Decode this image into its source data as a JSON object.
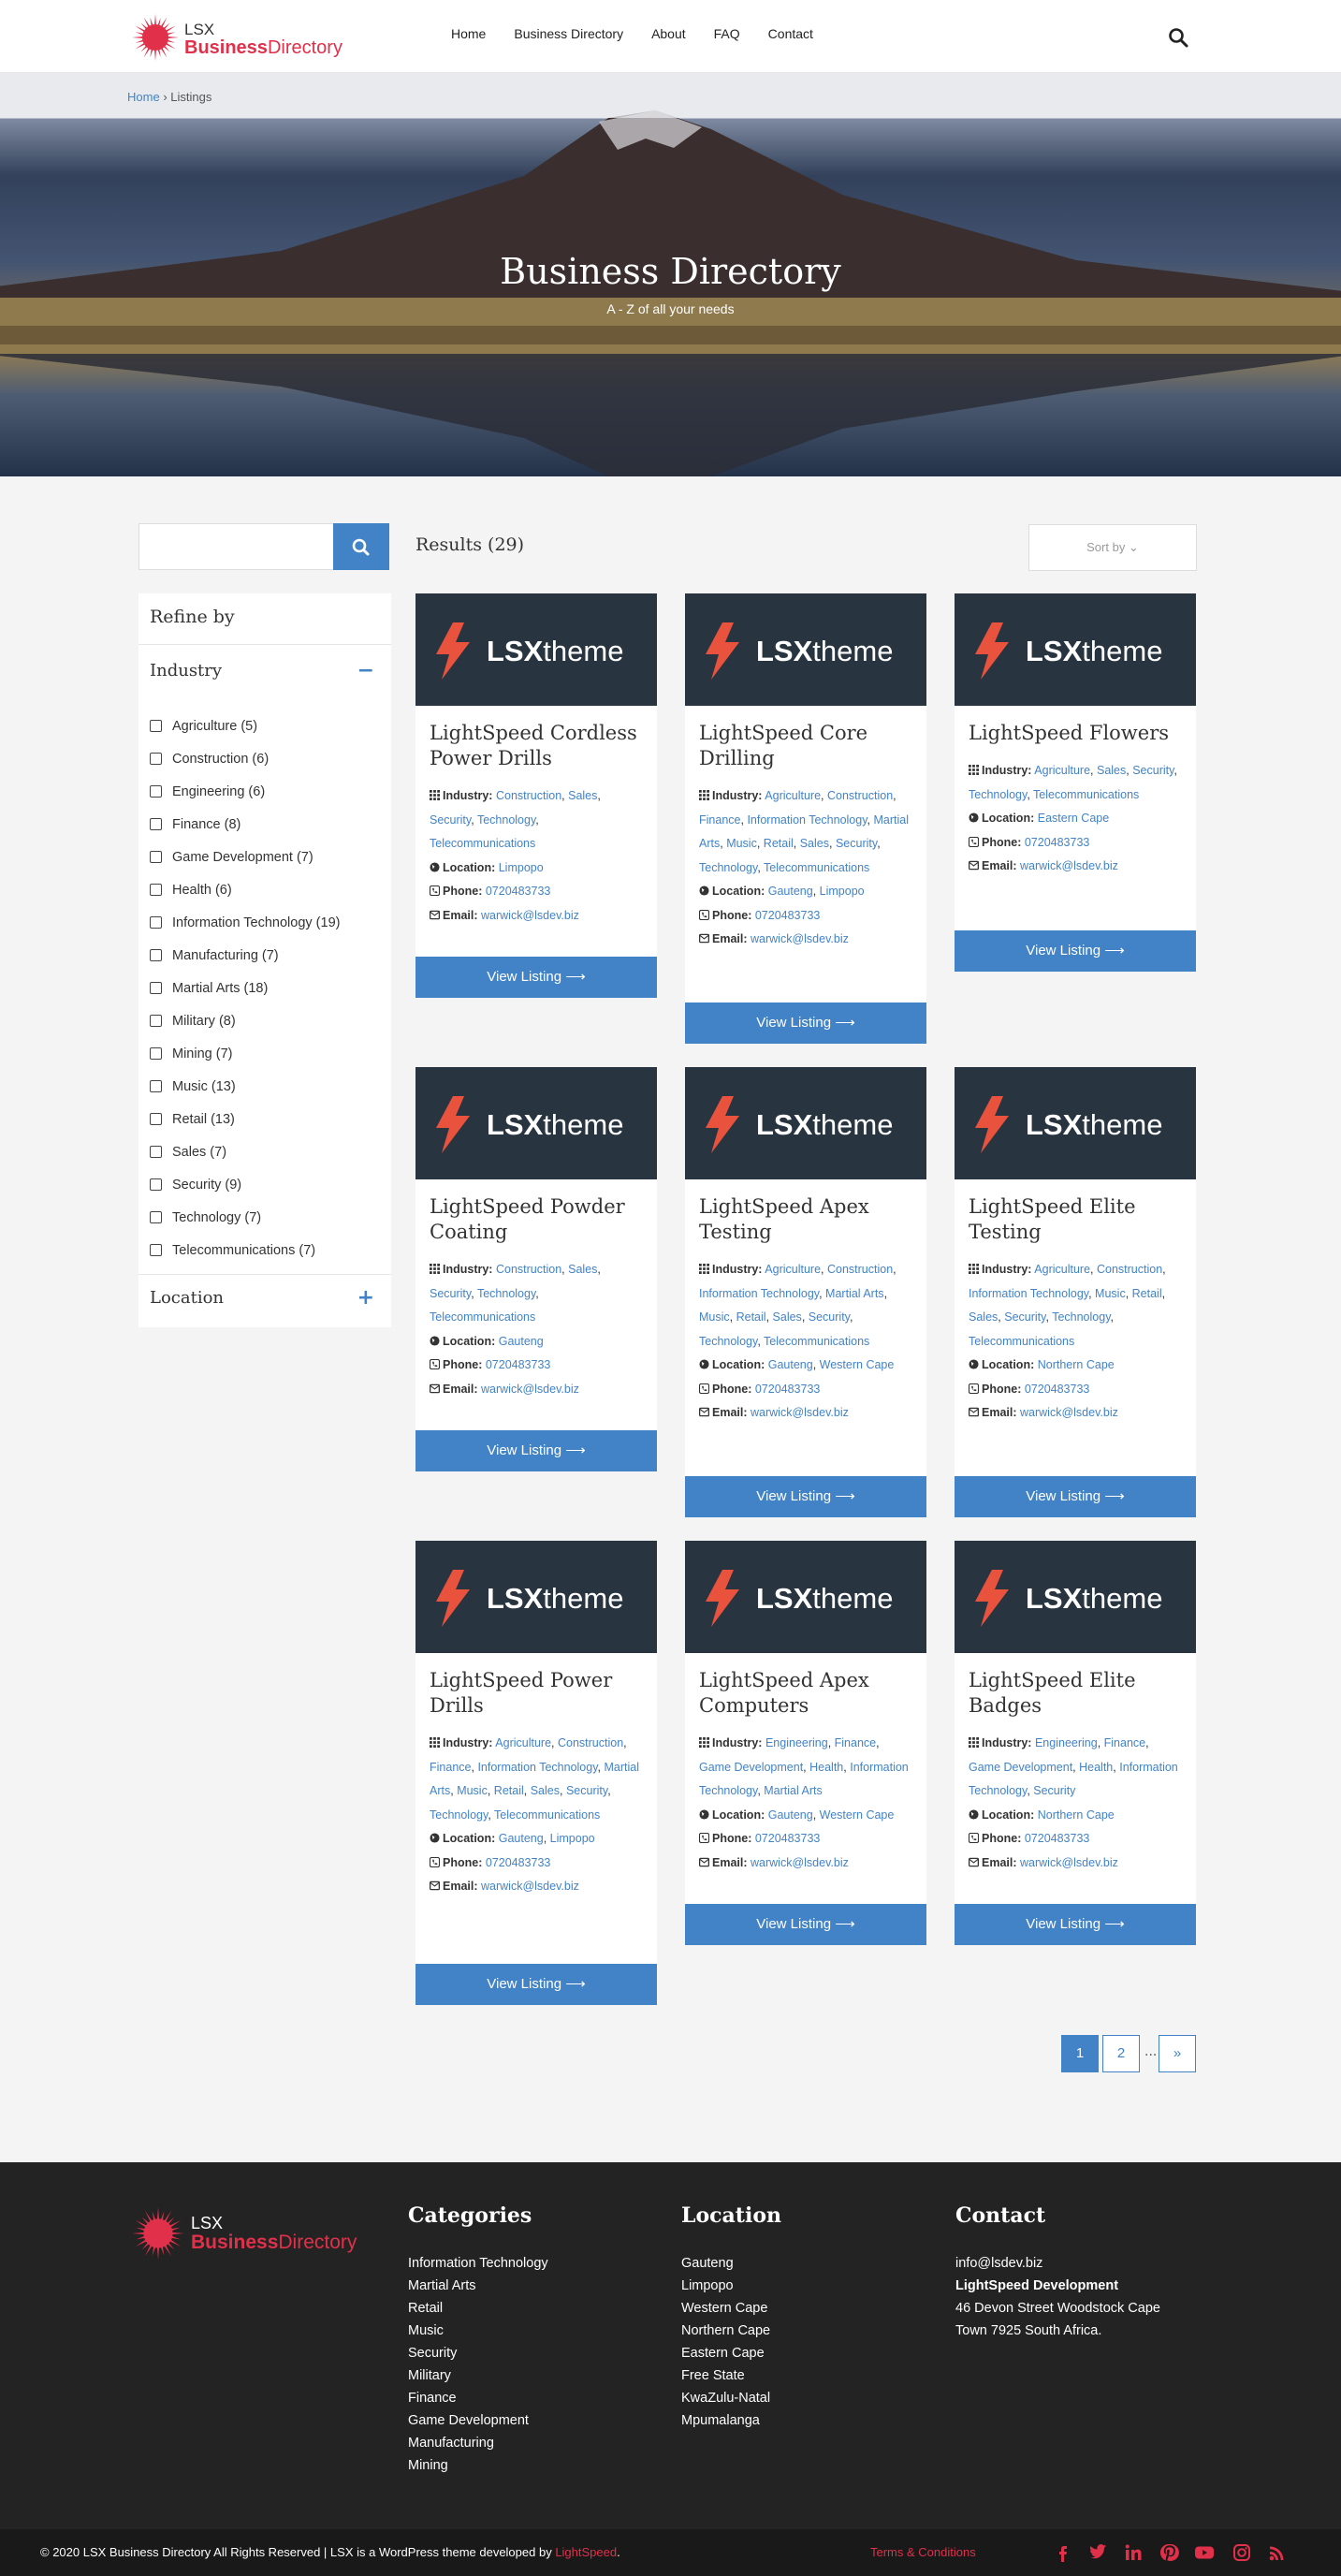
{
  "header": {
    "logo_top": "LSX",
    "logo_bold": "Business",
    "logo_rest": "Directory",
    "nav": [
      "Home",
      "Business Directory",
      "About",
      "FAQ",
      "Contact"
    ]
  },
  "breadcrumb": {
    "home": "Home",
    "sep": "›",
    "current": "Listings"
  },
  "hero": {
    "title": "Business Directory",
    "subtitle": "A - Z of all your needs"
  },
  "search": {
    "value": "",
    "placeholder": ""
  },
  "filters": {
    "refine_label": "Refine by",
    "industry_label": "Industry",
    "industry_toggle": "−",
    "location_label": "Location",
    "location_toggle": "+",
    "industries": [
      "Agriculture (5)",
      "Construction (6)",
      "Engineering (6)",
      "Finance (8)",
      "Game Development (7)",
      "Health (6)",
      "Information Technology (19)",
      "Manufacturing (7)",
      "Martial Arts (18)",
      "Military (8)",
      "Mining (7)",
      "Music (13)",
      "Retail (13)",
      "Sales (7)",
      "Security (9)",
      "Technology (7)",
      "Telecommunications (7)"
    ]
  },
  "results": {
    "label": "Results (29)",
    "sort_label": "Sort by ⌄"
  },
  "labels": {
    "industry": "Industry:",
    "location": "Location:",
    "phone": "Phone:",
    "email": "Email:",
    "view": "View Listing ⟶",
    "thumb_bold": "LSX",
    "thumb_rest": "theme"
  },
  "listings": [
    {
      "title": "LightSpeed Cordless Power Drills",
      "industry": "Construction, Sales, Security, Technology, Telecommunications",
      "location": "Limpopo",
      "phone": "0720483733",
      "email": "warwick@lsdev.biz"
    },
    {
      "title": "LightSpeed Core Drilling",
      "industry": "Agriculture, Construction, Finance, Information Technology, Martial Arts, Music, Retail, Sales, Security, Technology, Telecommunications",
      "location": "Gauteng, Limpopo",
      "phone": "0720483733",
      "email": "warwick@lsdev.biz"
    },
    {
      "title": "LightSpeed Flowers",
      "industry": "Agriculture, Sales, Security, Technology, Telecommunications",
      "location": "Eastern Cape",
      "phone": "0720483733",
      "email": "warwick@lsdev.biz"
    },
    {
      "title": "LightSpeed Powder Coating",
      "industry": "Construction, Sales, Security, Technology, Telecommunications",
      "location": "Gauteng",
      "phone": "0720483733",
      "email": "warwick@lsdev.biz"
    },
    {
      "title": "LightSpeed Apex Testing",
      "industry": "Agriculture, Construction, Information Technology, Martial Arts, Music, Retail, Sales, Security, Technology, Telecommunications",
      "location": "Gauteng, Western Cape",
      "phone": "0720483733",
      "email": "warwick@lsdev.biz"
    },
    {
      "title": "LightSpeed Elite Testing",
      "industry": "Agriculture, Construction, Information Technology, Music, Retail, Sales, Security, Technology, Telecommunications",
      "location": "Northern Cape",
      "phone": "0720483733",
      "email": "warwick@lsdev.biz"
    },
    {
      "title": "LightSpeed Power Drills",
      "industry": "Agriculture, Construction, Finance, Information Technology, Martial Arts, Music, Retail, Sales, Security, Technology, Telecommunications",
      "location": "Gauteng, Limpopo",
      "phone": "0720483733",
      "email": "warwick@lsdev.biz"
    },
    {
      "title": "LightSpeed Apex Computers",
      "industry": "Engineering, Finance, Game Development, Health, Information Technology, Martial Arts",
      "location": "Gauteng, Western Cape",
      "phone": "0720483733",
      "email": "warwick@lsdev.biz"
    },
    {
      "title": "LightSpeed Elite Badges",
      "industry": "Engineering, Finance, Game Development, Health, Information Technology, Security",
      "location": "Northern Cape",
      "phone": "0720483733",
      "email": "warwick@lsdev.biz"
    }
  ],
  "pagination": {
    "p1": "1",
    "p2": "2",
    "dots": "...",
    "next": "»"
  },
  "footer": {
    "categories_title": "Categories",
    "categories": [
      "Information Technology",
      "Martial Arts",
      "Retail",
      "Music",
      "Security",
      "Military",
      "Finance",
      "Game Development",
      "Manufacturing",
      "Mining"
    ],
    "location_title": "Location",
    "locations": [
      "Gauteng",
      "Limpopo",
      "Western Cape",
      "Northern Cape",
      "Eastern Cape",
      "Free State",
      "KwaZulu-Natal",
      "Mpumalanga"
    ],
    "contact_title": "Contact",
    "contact_email": "info@lsdev.biz",
    "contact_company": "LightSpeed Development",
    "contact_address1": "46 Devon Street Woodstock Cape",
    "contact_address2": "Town 7925 South Africa."
  },
  "bottom": {
    "copyright": "© 2020 LSX Business Directory All Rights Reserved | LSX is a WordPress theme developed by ",
    "developer": "LightSpeed",
    "period": ".",
    "terms": "Terms & Conditions",
    "social": [
      "facebook-icon",
      "twitter-icon",
      "linkedin-icon",
      "pinterest-icon",
      "youtube-icon",
      "instagram-icon",
      "rss-icon"
    ]
  },
  "colors": {
    "accent": "#4283c8",
    "brand": "#e0304a",
    "thumb_bg": "#283541",
    "footer_bg": "#232323"
  }
}
